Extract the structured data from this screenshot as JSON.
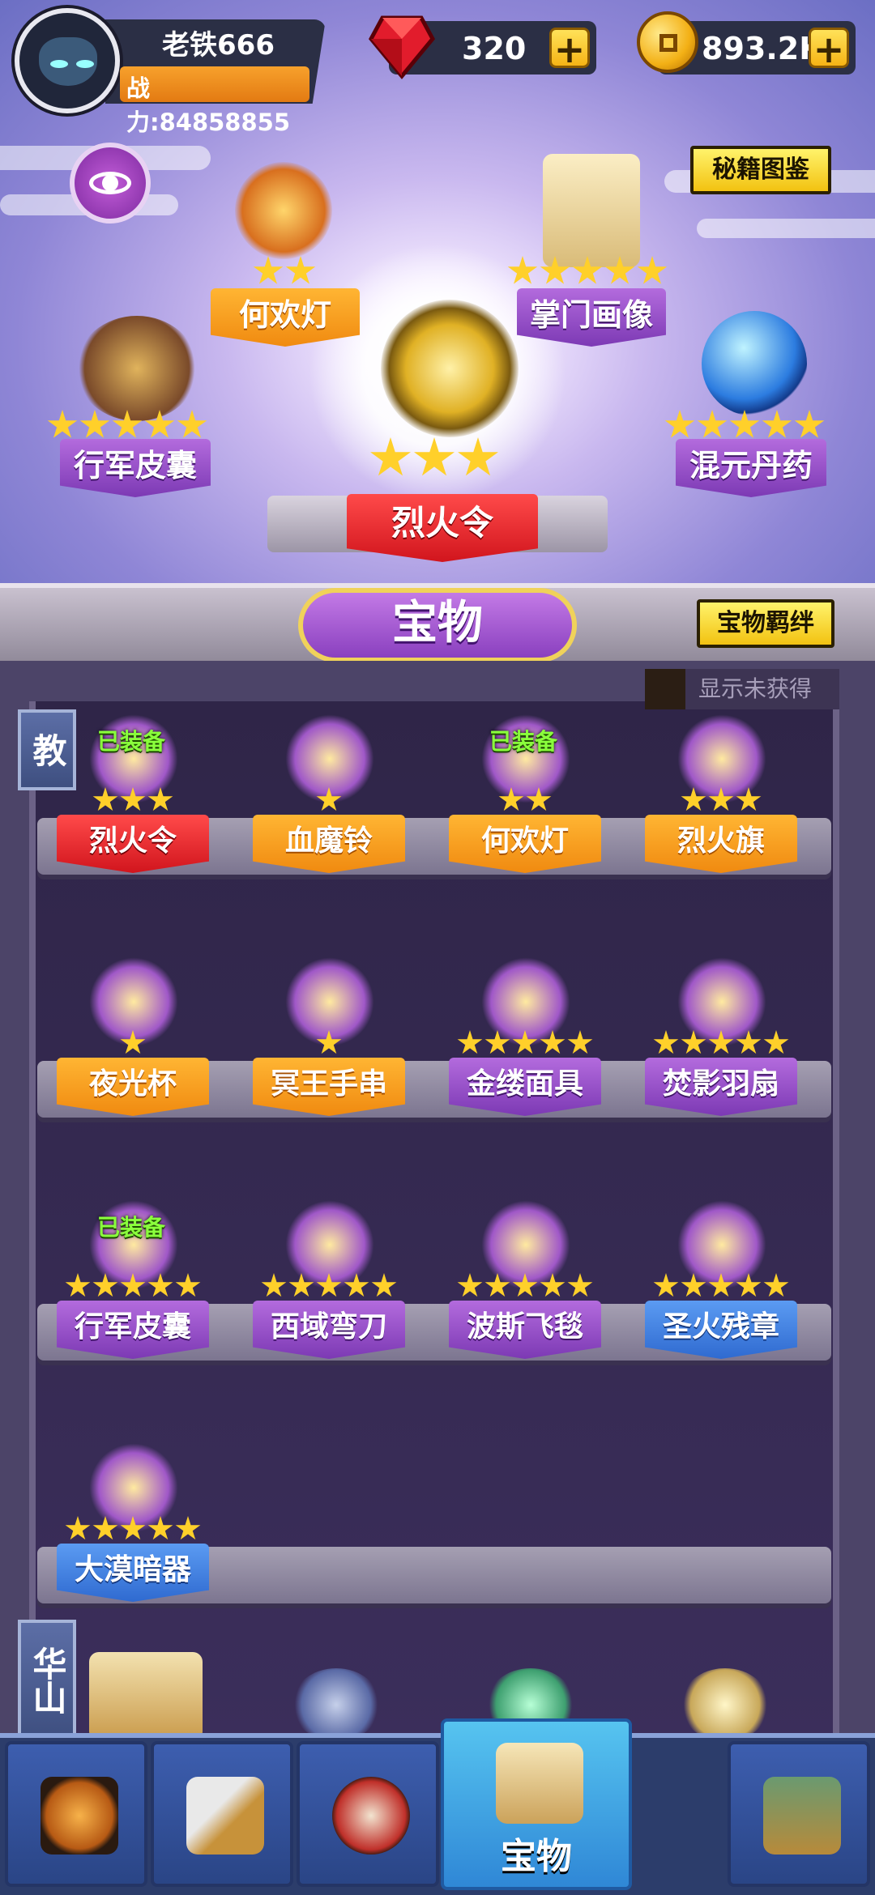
{
  "header": {
    "name": "老铁666",
    "power": "战力:84858855",
    "gems": "320",
    "coins": "893.2K",
    "plus": "+"
  },
  "buttons": {
    "secret_book": "秘籍图鉴",
    "treasure_bond": "宝物羁绊",
    "show_unobtained": "显示未获得"
  },
  "display": {
    "center": {
      "label": "烈火令",
      "stars": 3
    },
    "left_top": {
      "label": "何欢灯",
      "stars": 2
    },
    "right_top": {
      "label": "掌门画像",
      "stars": 5
    },
    "left_mid": {
      "label": "行军皮囊",
      "stars": 5
    },
    "right_mid": {
      "label": "混元丹药",
      "stars": 5
    }
  },
  "section_title": "宝物",
  "categories": [
    "教",
    "华山"
  ],
  "equipped_text": "已装备",
  "rows": [
    [
      {
        "label": "烈火令",
        "stars": 3,
        "color": "red",
        "equipped": true
      },
      {
        "label": "血魔铃",
        "stars": 1,
        "color": "orange",
        "equipped": false
      },
      {
        "label": "何欢灯",
        "stars": 2,
        "color": "orange",
        "equipped": true
      },
      {
        "label": "烈火旗",
        "stars": 3,
        "color": "orange",
        "equipped": false
      }
    ],
    [
      {
        "label": "夜光杯",
        "stars": 1,
        "color": "orange",
        "equipped": false
      },
      {
        "label": "冥王手串",
        "stars": 1,
        "color": "orange",
        "equipped": false
      },
      {
        "label": "金缕面具",
        "stars": 5,
        "color": "purple",
        "equipped": false
      },
      {
        "label": "焚影羽扇",
        "stars": 5,
        "color": "purple",
        "equipped": false
      }
    ],
    [
      {
        "label": "行军皮囊",
        "stars": 5,
        "color": "purple",
        "equipped": true
      },
      {
        "label": "西域弯刀",
        "stars": 5,
        "color": "purple",
        "equipped": false
      },
      {
        "label": "波斯飞毯",
        "stars": 5,
        "color": "purple",
        "equipped": false
      },
      {
        "label": "圣火残章",
        "stars": 5,
        "color": "blue",
        "equipped": false
      }
    ],
    [
      {
        "label": "大漠暗器",
        "stars": 5,
        "color": "blue",
        "equipped": false
      }
    ]
  ],
  "tabs": [
    {
      "label": ""
    },
    {
      "label": ""
    },
    {
      "label": ""
    },
    {
      "label": "宝物"
    },
    {
      "label": ""
    }
  ],
  "colors": {
    "orange": "#f08a10",
    "purple": "#7c39b4",
    "blue": "#2f6ad0",
    "red": "#d1151d",
    "star": "#ffd02a",
    "equipped": "#8aff3c"
  }
}
